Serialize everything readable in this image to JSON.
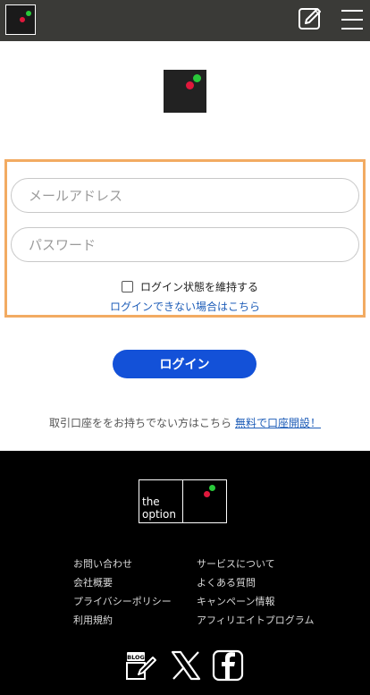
{
  "header": {
    "logo_icon": "theoption-logo-icon",
    "edit_icon": "edit-note-icon",
    "menu_icon": "hamburger-menu-icon",
    "background_color": "#3a3a37"
  },
  "login_form": {
    "email_placeholder": "メールアドレス",
    "password_placeholder": "パスワード",
    "remember_label": "ログイン状態を維持する",
    "remember_checked": false,
    "forgot_link": "ログインできない場合はこちら",
    "highlight_color": "#f2ab62"
  },
  "login_button": {
    "label": "ログイン",
    "color": "#1351d8"
  },
  "signup": {
    "text": "取引口座ををお持ちでない方はこちら",
    "link": "無料で口座開設！"
  },
  "footer": {
    "logo_line1": "the",
    "logo_line2": "option",
    "links_left": [
      "お問い合わせ",
      "会社概要",
      "プライバシーポリシー",
      "利用規約"
    ],
    "links_right": [
      "サービスについて",
      "よくある質問",
      "キャンペーン情報",
      "アフィリエイトプログラム"
    ],
    "social_icons": [
      "blog-icon",
      "x-icon",
      "facebook-icon"
    ],
    "blog_badge": "BLOG"
  },
  "colors": {
    "brand_green": "#29c93a",
    "brand_red": "#e0183c",
    "link_blue": "#1e5db8"
  }
}
